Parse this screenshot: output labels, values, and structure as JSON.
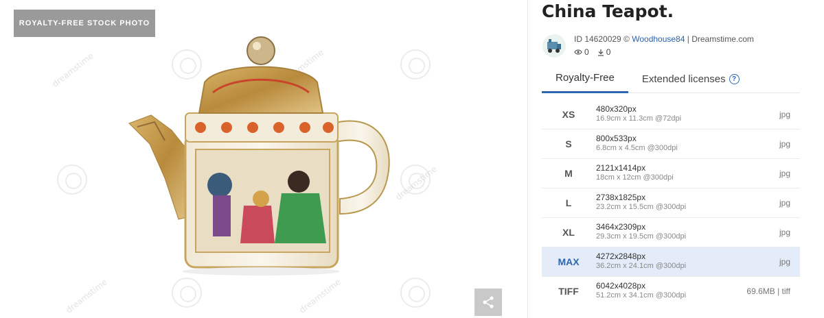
{
  "badge": "ROYALTY-FREE STOCK PHOTO",
  "watermark_text": "dreamstime",
  "title": "China Teapot.",
  "meta": {
    "id_prefix": "ID 14620029 © ",
    "author": "Woodhouse84",
    "site": " | Dreamstime.com",
    "views": "0",
    "downloads": "0"
  },
  "tabs": {
    "royalty_free": "Royalty-Free",
    "extended": "Extended licenses",
    "help": "?"
  },
  "sizes": [
    {
      "code": "XS",
      "dims": "480x320px",
      "phys": "16.9cm x 11.3cm @72dpi",
      "fmt": "jpg"
    },
    {
      "code": "S",
      "dims": "800x533px",
      "phys": "6.8cm x 4.5cm @300dpi",
      "fmt": "jpg"
    },
    {
      "code": "M",
      "dims": "2121x1414px",
      "phys": "18cm x 12cm @300dpi",
      "fmt": "jpg"
    },
    {
      "code": "L",
      "dims": "2738x1825px",
      "phys": "23.2cm x 15.5cm @300dpi",
      "fmt": "jpg"
    },
    {
      "code": "XL",
      "dims": "3464x2309px",
      "phys": "29.3cm x 19.5cm @300dpi",
      "fmt": "jpg"
    },
    {
      "code": "MAX",
      "dims": "4272x2848px",
      "phys": "36.2cm x 24.1cm @300dpi",
      "fmt": "jpg"
    },
    {
      "code": "TIFF",
      "dims": "6042x4028px",
      "phys": "51.2cm x 34.1cm @300dpi",
      "fmt": "69.6MB | tiff"
    }
  ],
  "colors": {
    "accent": "#2d66b0",
    "selected_row": "#e3ecf8",
    "badge_bg": "#9a9a9a"
  },
  "icons": {
    "share": "share-icon",
    "views": "eye-icon",
    "downloads": "download-icon",
    "help": "question-circle-icon"
  }
}
